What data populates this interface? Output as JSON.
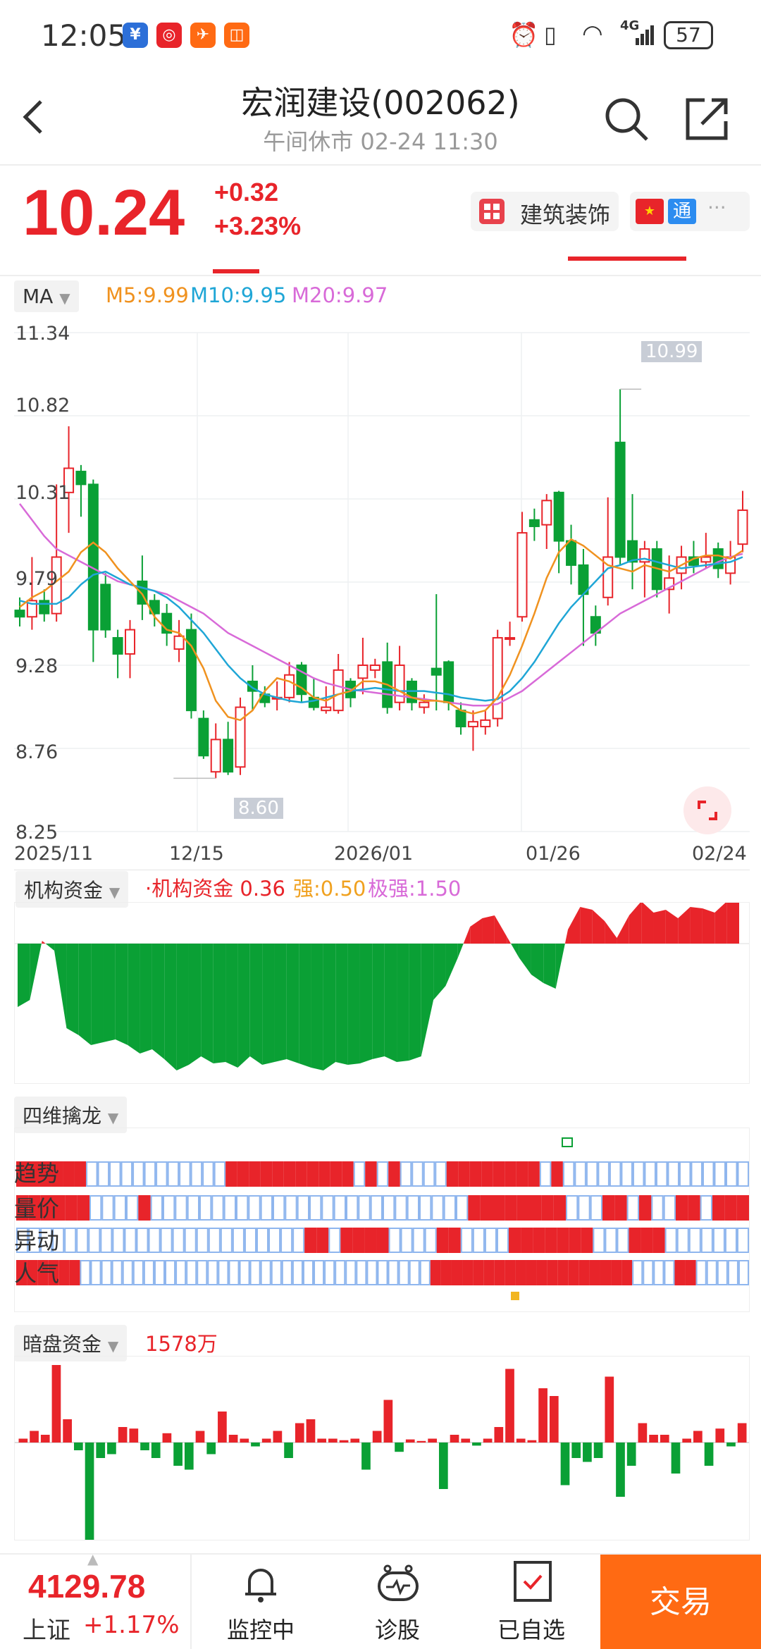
{
  "status_bar": {
    "time": "12:05",
    "app_icons": [
      "notification-icon-1",
      "notification-icon-2",
      "notification-icon-3",
      "notification-icon-4"
    ],
    "battery": "57",
    "network": "4G"
  },
  "header": {
    "title": "宏润建设(002062)",
    "subtitle": "午间休市 02-24 11:30"
  },
  "quote": {
    "price": "10.24",
    "change": "+0.32",
    "change_pct": "+3.23%",
    "sector": "建筑装饰",
    "tag_cn_flag": "china-flag-icon",
    "tag_tong": "通",
    "more": "···"
  },
  "ma_bar": {
    "selector": "MA",
    "m5": "M5:9.99",
    "m10": "M10:9.95",
    "m20": "M20:9.97",
    "colors": {
      "m5": "#f0921f",
      "m10": "#1fa6d6",
      "m20": "#d86ad8"
    }
  },
  "colors": {
    "up": "#e8242a",
    "down": "#0aa035",
    "accent": "#ff6a13",
    "hollow": "#8fb6ee"
  },
  "chart_data": [
    {
      "type": "candlestick",
      "y_ticks": [
        "11.34",
        "10.82",
        "10.31",
        "9.79",
        "9.28",
        "8.76",
        "8.25"
      ],
      "ylim": [
        8.25,
        11.34
      ],
      "x_ticks": [
        "2025/11",
        "12/15",
        "2026/01",
        "01/26",
        "02/24"
      ],
      "high_label": "10.99",
      "low_label": "8.60",
      "candles": [
        [
          9.62,
          9.58,
          9.7,
          9.52
        ],
        [
          9.58,
          9.68,
          9.95,
          9.5
        ],
        [
          9.68,
          9.6,
          9.75,
          9.55
        ],
        [
          9.6,
          9.95,
          10.4,
          9.55
        ],
        [
          10.35,
          10.5,
          10.76,
          10.1
        ],
        [
          10.48,
          10.4,
          10.52,
          10.2
        ],
        [
          10.4,
          9.5,
          10.43,
          9.3
        ],
        [
          9.78,
          9.5,
          9.85,
          9.45
        ],
        [
          9.45,
          9.35,
          9.5,
          9.2
        ],
        [
          9.35,
          9.5,
          9.56,
          9.2
        ],
        [
          9.8,
          9.66,
          9.96,
          9.56
        ],
        [
          9.68,
          9.6,
          9.72,
          9.52
        ],
        [
          9.6,
          9.48,
          9.66,
          9.4
        ],
        [
          9.38,
          9.46,
          9.56,
          9.3
        ],
        [
          9.5,
          9.0,
          9.6,
          8.95
        ],
        [
          8.95,
          8.72,
          9.0,
          8.7
        ],
        [
          8.62,
          8.82,
          8.92,
          8.58
        ],
        [
          8.82,
          8.62,
          8.93,
          8.6
        ],
        [
          8.65,
          9.02,
          9.08,
          8.6
        ],
        [
          9.18,
          9.12,
          9.28,
          9.0
        ],
        [
          9.1,
          9.05,
          9.15,
          9.02
        ],
        [
          9.08,
          9.08,
          9.18,
          9.0
        ],
        [
          9.08,
          9.22,
          9.3,
          9.05
        ],
        [
          9.28,
          9.1,
          9.3,
          9.05
        ],
        [
          9.08,
          9.02,
          9.2,
          9.0
        ],
        [
          9.0,
          9.02,
          9.15,
          8.98
        ],
        [
          9.0,
          9.25,
          9.35,
          8.98
        ],
        [
          9.18,
          9.08,
          9.2,
          9.02
        ],
        [
          9.2,
          9.28,
          9.45,
          9.1
        ],
        [
          9.25,
          9.28,
          9.32,
          9.2
        ],
        [
          9.3,
          9.02,
          9.42,
          8.98
        ],
        [
          9.05,
          9.28,
          9.4,
          9.0
        ],
        [
          9.18,
          9.05,
          9.2,
          9.0
        ],
        [
          9.02,
          9.05,
          9.1,
          8.98
        ],
        [
          9.26,
          9.22,
          9.72,
          9.0
        ],
        [
          9.3,
          9.05,
          9.31,
          9.0
        ],
        [
          9.0,
          8.9,
          9.05,
          8.85
        ],
        [
          8.9,
          8.93,
          9.0,
          8.75
        ],
        [
          8.9,
          8.94,
          9.0,
          8.85
        ],
        [
          8.95,
          9.45,
          9.5,
          8.9
        ],
        [
          9.45,
          9.45,
          9.55,
          9.4
        ],
        [
          9.58,
          10.1,
          10.23,
          9.55
        ],
        [
          10.18,
          10.14,
          10.25,
          10.05
        ],
        [
          10.15,
          10.3,
          10.34,
          10.0
        ],
        [
          10.35,
          10.05,
          10.36,
          9.85
        ],
        [
          10.05,
          9.9,
          10.15,
          9.78
        ],
        [
          9.9,
          9.72,
          10.0,
          9.4
        ],
        [
          9.58,
          9.48,
          9.65,
          9.4
        ],
        [
          9.7,
          9.95,
          10.32,
          9.65
        ],
        [
          10.66,
          9.95,
          10.99,
          9.9
        ],
        [
          10.05,
          9.92,
          10.34,
          9.75
        ],
        [
          9.92,
          10.0,
          10.05,
          9.7
        ],
        [
          10.0,
          9.75,
          10.05,
          9.7
        ],
        [
          9.75,
          9.82,
          9.96,
          9.6
        ],
        [
          9.85,
          9.95,
          10.02,
          9.75
        ],
        [
          9.95,
          9.9,
          10.05,
          9.85
        ],
        [
          9.92,
          9.95,
          10.1,
          9.88
        ],
        [
          10.0,
          9.88,
          10.04,
          9.82
        ],
        [
          9.85,
          9.95,
          10.05,
          9.78
        ],
        [
          10.03,
          10.24,
          10.36,
          9.98
        ]
      ],
      "ma5": [
        9.64,
        9.7,
        9.74,
        9.8,
        9.86,
        9.98,
        10.04,
        9.98,
        9.88,
        9.8,
        9.72,
        9.58,
        9.5,
        9.48,
        9.4,
        9.26,
        9.06,
        8.96,
        8.94,
        9.0,
        9.12,
        9.2,
        9.18,
        9.14,
        9.08,
        9.06,
        9.1,
        9.12,
        9.18,
        9.18,
        9.16,
        9.12,
        9.08,
        9.06,
        9.06,
        9.05,
        9.0,
        8.98,
        9.0,
        9.08,
        9.22,
        9.4,
        9.6,
        9.82,
        9.98,
        10.06,
        10.02,
        9.96,
        9.9,
        9.88,
        9.86,
        9.9,
        9.88,
        9.86,
        9.9,
        9.94,
        9.96,
        9.96,
        9.94,
        9.99
      ],
      "ma10": [
        9.68,
        9.66,
        9.66,
        9.66,
        9.7,
        9.78,
        9.84,
        9.86,
        9.82,
        9.78,
        9.76,
        9.74,
        9.7,
        9.64,
        9.56,
        9.48,
        9.38,
        9.28,
        9.2,
        9.14,
        9.1,
        9.08,
        9.06,
        9.05,
        9.06,
        9.08,
        9.1,
        9.12,
        9.13,
        9.14,
        9.13,
        9.12,
        9.12,
        9.12,
        9.11,
        9.1,
        9.08,
        9.07,
        9.06,
        9.07,
        9.12,
        9.2,
        9.3,
        9.42,
        9.54,
        9.64,
        9.72,
        9.8,
        9.88,
        9.9,
        9.93,
        9.94,
        9.92,
        9.9,
        9.88,
        9.89,
        9.9,
        9.91,
        9.92,
        9.95
      ],
      "ma20": [
        10.28,
        10.18,
        10.08,
        10.0,
        9.96,
        9.92,
        9.88,
        9.84,
        9.8,
        9.78,
        9.76,
        9.74,
        9.72,
        9.68,
        9.64,
        9.6,
        9.54,
        9.48,
        9.44,
        9.4,
        9.36,
        9.32,
        9.28,
        9.24,
        9.2,
        9.17,
        9.15,
        9.13,
        9.12,
        9.11,
        9.1,
        9.09,
        9.08,
        9.07,
        9.06,
        9.05,
        9.04,
        9.03,
        9.03,
        9.04,
        9.08,
        9.12,
        9.18,
        9.24,
        9.3,
        9.36,
        9.42,
        9.48,
        9.54,
        9.6,
        9.64,
        9.68,
        9.72,
        9.76,
        9.8,
        9.84,
        9.88,
        9.92,
        9.95,
        9.97
      ]
    },
    {
      "type": "area",
      "title": "机构资金",
      "legend": [
        "·机构资金 0.36",
        "强:0.50",
        "极强:1.50"
      ],
      "values": [
        -0.45,
        -0.4,
        0.02,
        -0.05,
        -0.6,
        -0.65,
        -0.72,
        -0.7,
        -0.68,
        -0.72,
        -0.78,
        -0.75,
        -0.82,
        -0.9,
        -0.86,
        -0.8,
        -0.85,
        -0.84,
        -0.88,
        -0.8,
        -0.86,
        -0.84,
        -0.82,
        -0.85,
        -0.88,
        -0.9,
        -0.84,
        -0.86,
        -0.85,
        -0.82,
        -0.8,
        -0.84,
        -0.83,
        -0.8,
        -0.4,
        -0.3,
        -0.1,
        0.12,
        0.18,
        0.2,
        0.05,
        -0.1,
        -0.22,
        -0.28,
        -0.32,
        0.1,
        0.26,
        0.24,
        0.16,
        0.04,
        0.2,
        0.3,
        0.22,
        0.24,
        0.18,
        0.26,
        0.25,
        0.22,
        0.3,
        0.36
      ]
    },
    {
      "type": "table",
      "title": "四维擒龙",
      "rows": [
        "趋势",
        "量价",
        "异动",
        "人气"
      ],
      "states": [
        "RRRRRRHHHHHHHHHHHHRRRRRRRRRRRHRHRHHHHRRRRRRRRHRHHHHHHHHHHHHHHHH",
        "RRRRRRHHHHRHHHHHHHHHHHHHHHHHHHHHHHHHHRRRRRRRRHHHRRHRHHRRHRRR",
        "HHHHHHHHHHHHHHHHHHHHHHHHRRHRRRRHHHHRRHHHHRRRRRRRHHHRRRHHHHHHH",
        "RRRRRRHHHHHHHHHHHHHHHHHHHHHHHHHHHHHHHHHRRRRRRRRRRRRRRRRRRRHHHHRRHHHHH"
      ]
    },
    {
      "type": "bar",
      "title": "暗盘资金",
      "value_label": "1578万",
      "values": [
        0.05,
        0.15,
        0.1,
        1.0,
        0.3,
        -0.1,
        -1.3,
        -0.2,
        -0.15,
        0.2,
        0.18,
        -0.1,
        -0.2,
        0.12,
        -0.3,
        -0.35,
        0.15,
        -0.15,
        0.4,
        0.1,
        0.05,
        -0.05,
        0.05,
        0.15,
        -0.2,
        0.25,
        0.3,
        0.05,
        0.05,
        0.03,
        0.05,
        -0.35,
        0.15,
        0.55,
        -0.12,
        0.04,
        0.02,
        0.05,
        -0.6,
        0.1,
        0.05,
        -0.04,
        0.05,
        0.2,
        0.95,
        0.05,
        0.03,
        0.7,
        0.6,
        -0.55,
        -0.2,
        -0.25,
        -0.2,
        0.85,
        -0.7,
        -0.3,
        0.25,
        0.1,
        0.1,
        -0.4,
        0.05,
        0.15,
        -0.3,
        0.18,
        -0.05,
        0.25
      ]
    }
  ],
  "panels": {
    "inst_selector": "机构资金",
    "inst_legend": "·机构资金 0.36",
    "inst_strong": "强:0.50",
    "inst_extreme": "极强:1.50",
    "siwei_selector": "四维擒龙",
    "rows": [
      "趋势",
      "量价",
      "异动",
      "人气"
    ],
    "dark_selector": "暗盘资金",
    "dark_value": "1578万"
  },
  "bottom_bar": {
    "index_value": "4129.78",
    "index_name": "上证",
    "index_pct": "+1.17%",
    "monitor": "监控中",
    "diagnose": "诊股",
    "watchlist": "已自选",
    "trade": "交易"
  }
}
